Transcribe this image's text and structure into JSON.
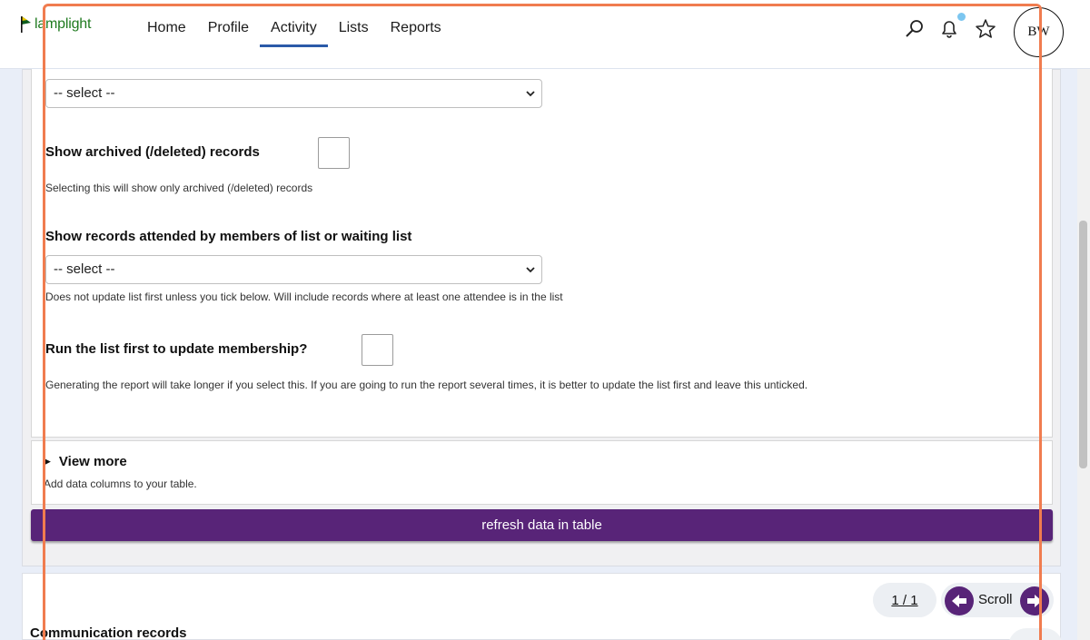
{
  "header": {
    "logo_text": "lamplight",
    "nav": [
      "Home",
      "Profile",
      "Activity",
      "Lists",
      "Reports"
    ],
    "active_nav": "Activity",
    "icons": [
      "search-icon",
      "bell-icon",
      "star-icon"
    ],
    "avatar_initials": "BW"
  },
  "filters": {
    "top_select_value": "-- select --",
    "archived_label": "Show archived (/deleted) records",
    "archived_hint": "Selecting this will show only archived (/deleted) records",
    "attended_label": "Show records attended by members of list or waiting list",
    "attended_select_value": "-- select --",
    "attended_hint": "Does not update list first unless you tick below. Will include records where at least one attendee is in the list",
    "run_list_label": "Run the list first to update membership?",
    "run_list_hint": "Generating the report will take longer if you select this. If you are going to run the report several times, it is better to update the list first and leave this unticked."
  },
  "view_more": {
    "title": "View more",
    "hint": "Add data columns to your table."
  },
  "refresh_button": "refresh data in table",
  "records": {
    "pager": "1 / 1",
    "scroll_label": "Scroll",
    "title": "Communication records"
  },
  "colors": {
    "accent_purple": "#582478",
    "nav_underline": "#2b5aa8",
    "logo_green": "#1f7a1f",
    "highlight_orange": "#f07c4f"
  }
}
